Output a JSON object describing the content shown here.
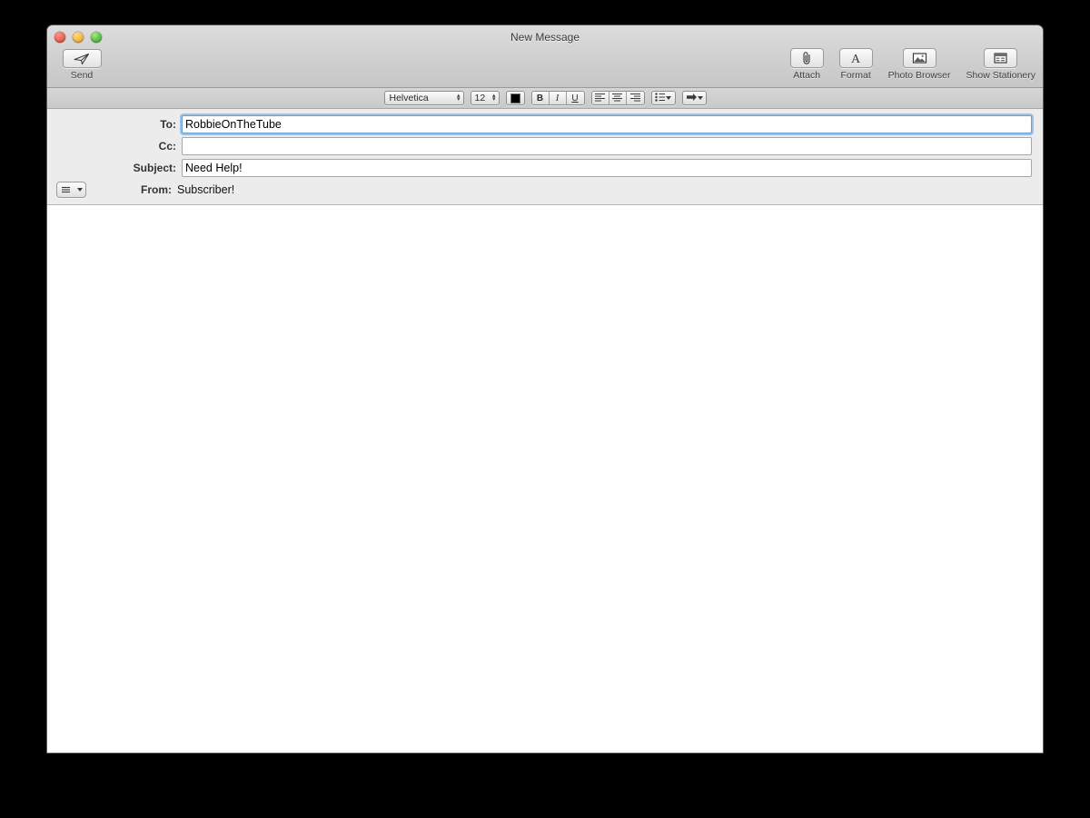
{
  "window": {
    "title": "New Message",
    "traffic_lights": [
      {
        "name": "close",
        "color": "#ed6a5e"
      },
      {
        "name": "minimize",
        "color": "#f4bd4f"
      },
      {
        "name": "zoom",
        "color": "#62c453"
      }
    ]
  },
  "toolbar": {
    "send": {
      "label": "Send",
      "icon": "paper-plane-icon"
    },
    "items": [
      {
        "label": "Attach",
        "icon": "paperclip-icon"
      },
      {
        "label": "Format",
        "icon": "letter-a-icon"
      },
      {
        "label": "Photo Browser",
        "icon": "photo-frame-icon"
      },
      {
        "label": "Show Stationery",
        "icon": "stationery-window-icon"
      }
    ]
  },
  "format_bar": {
    "font_family": "Helvetica",
    "font_size": "12",
    "color_swatch": "#000000",
    "bold_label": "B",
    "italic_label": "I",
    "underline_label": "U",
    "align_left_icon": "align-left-icon",
    "align_center_icon": "align-center-icon",
    "align_right_icon": "align-right-icon",
    "list_icon": "bulleted-list-icon",
    "indent_icon": "arrow-right-icon"
  },
  "headers": {
    "to": {
      "label": "To:",
      "value": "RobbieOnTheTube",
      "placeholder": ""
    },
    "cc": {
      "label": "Cc:",
      "value": "",
      "placeholder": ""
    },
    "subject": {
      "label": "Subject:",
      "value": "Need Help!",
      "placeholder": ""
    },
    "from": {
      "label": "From:",
      "value": "Subscriber!"
    },
    "menu_icon": "hamburger-icon"
  },
  "body": {
    "content": ""
  }
}
